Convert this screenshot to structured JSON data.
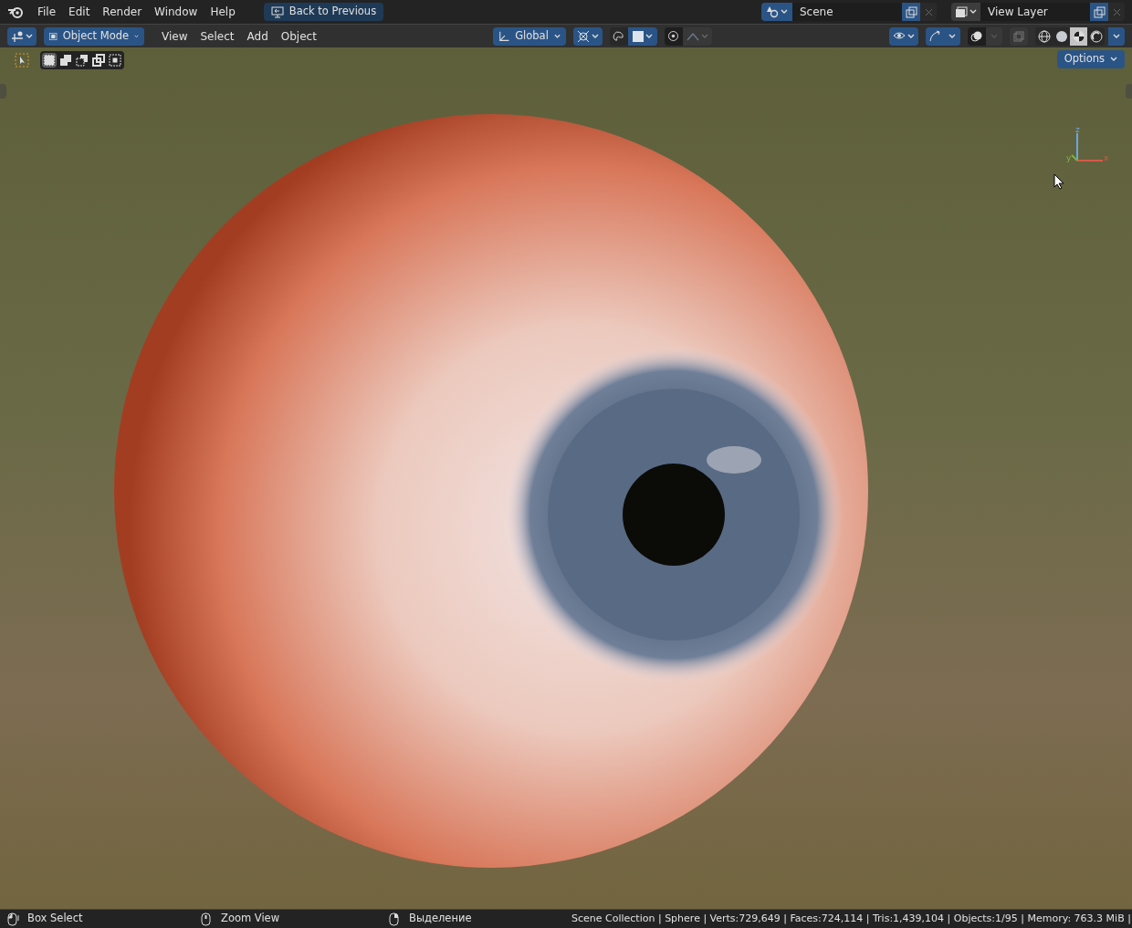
{
  "menu": [
    "File",
    "Edit",
    "Render",
    "Window",
    "Help"
  ],
  "back_button": "Back to Previous",
  "scene": {
    "value": "Scene"
  },
  "view_layer": {
    "value": "View Layer"
  },
  "header": {
    "mode": "Object Mode",
    "menus": [
      "View",
      "Select",
      "Add",
      "Object"
    ],
    "orientation": "Global"
  },
  "select_modes": [
    {
      "selected": true
    },
    {
      "selected": false
    },
    {
      "selected": false
    },
    {
      "selected": false
    },
    {
      "selected": false
    }
  ],
  "shading_modes": [
    {
      "kind": "wireframe",
      "selected": false
    },
    {
      "kind": "solid",
      "selected": false
    },
    {
      "kind": "material",
      "selected": true
    },
    {
      "kind": "rendered",
      "selected": false
    }
  ],
  "options_button": "Options",
  "gizmo": {
    "z": "z",
    "x": "x",
    "y": "y"
  },
  "status_bar": {
    "hints": [
      "Box Select",
      "Zoom View",
      "Выделение"
    ],
    "stats": "Scene Collection | Sphere | Verts:729,649 | Faces:724,114 | Tris:1,439,104 | Objects:1/95 | Memory: 763.3 MiB |"
  }
}
